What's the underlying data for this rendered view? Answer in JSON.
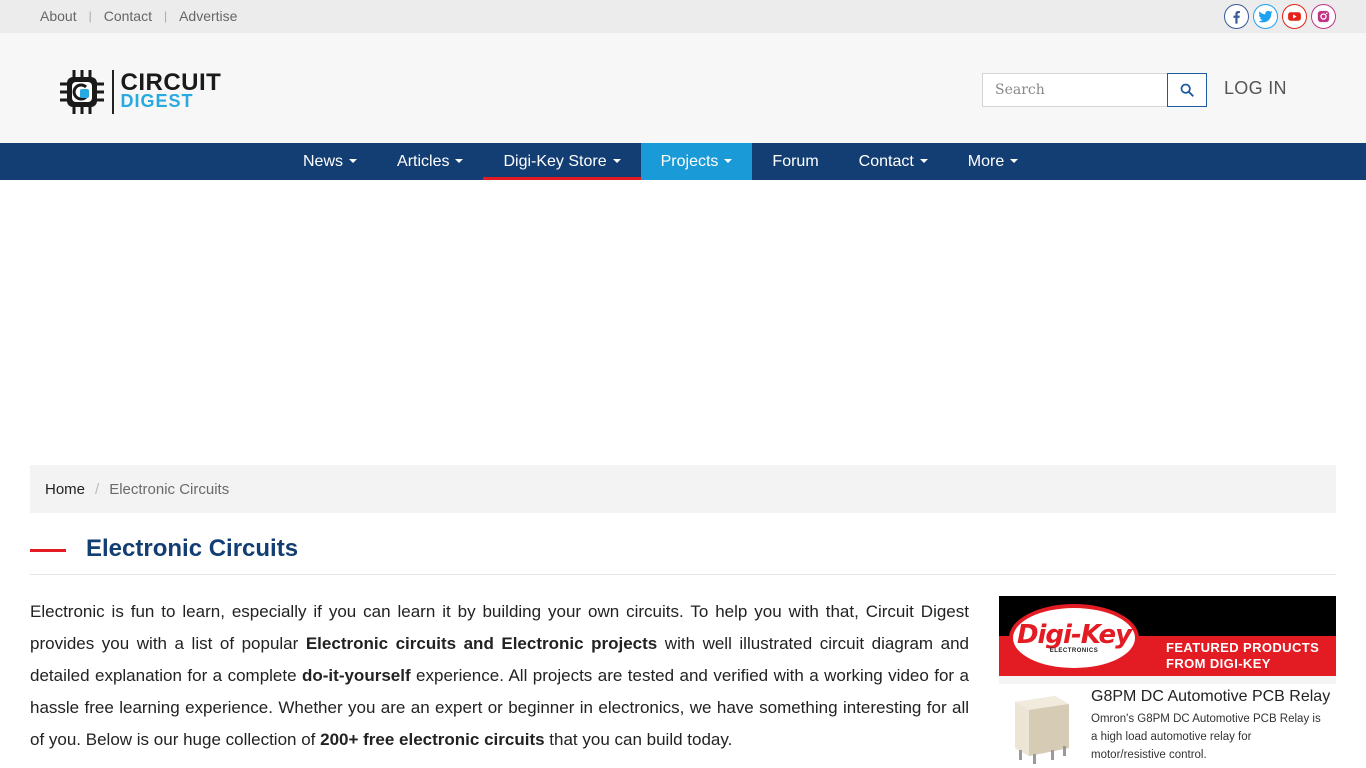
{
  "top_links": [
    "About",
    "Contact",
    "Advertise"
  ],
  "social": [
    {
      "name": "facebook-icon",
      "color": "#3b5998"
    },
    {
      "name": "twitter-icon",
      "color": "#1da1f2"
    },
    {
      "name": "youtube-icon",
      "color": "#e62117"
    },
    {
      "name": "instagram-icon",
      "color": "#c13584"
    }
  ],
  "logo": {
    "line1": "CIRCUIT",
    "line2": "DIGEST"
  },
  "search": {
    "placeholder": "Search"
  },
  "login_label": "LOG IN",
  "nav": [
    {
      "label": "News",
      "dropdown": true
    },
    {
      "label": "Articles",
      "dropdown": true
    },
    {
      "label": "Digi-Key Store",
      "dropdown": true
    },
    {
      "label": "Projects",
      "dropdown": true
    },
    {
      "label": "Forum",
      "dropdown": false
    },
    {
      "label": "Contact",
      "dropdown": true
    },
    {
      "label": "More",
      "dropdown": true
    }
  ],
  "breadcrumb": {
    "home": "Home",
    "separator": "/",
    "current": "Electronic Circuits"
  },
  "page_title": "Electronic Circuits",
  "intro": {
    "p1": "Electronic is fun to learn, especially if you can learn it by building your own circuits. To help you with that, Circuit Digest provides you with a list of popular ",
    "b1": "Electronic circuits and Electronic projects",
    "p2": " with well illustrated circuit diagram and detailed explanation for a complete ",
    "b2": "do-it-yourself",
    "p3": " experience. All projects are tested and verified with a working video for a hassle free learning experience. Whether you are an expert or beginner in electronics, we have something interesting for all of you. Below is our huge collection of ",
    "b3": "200+ free electronic circuits",
    "p4": " that you can build today."
  },
  "ad": {
    "brand": "Digi-Key",
    "brand_sub": "ELECTRONICS",
    "featured_line1": "FEATURED PRODUCTS",
    "featured_line2": "FROM DIGI-KEY",
    "product_title": "G8PM DC Automotive PCB Relay",
    "product_desc": "Omron's G8PM DC Automotive PCB Relay is a high load automotive relay for motor/resistive control."
  },
  "colors": {
    "nav_bg": "#133e73",
    "nav_active": "#1a9ad6",
    "accent_red": "#e31b23",
    "title_blue": "#133e73"
  }
}
